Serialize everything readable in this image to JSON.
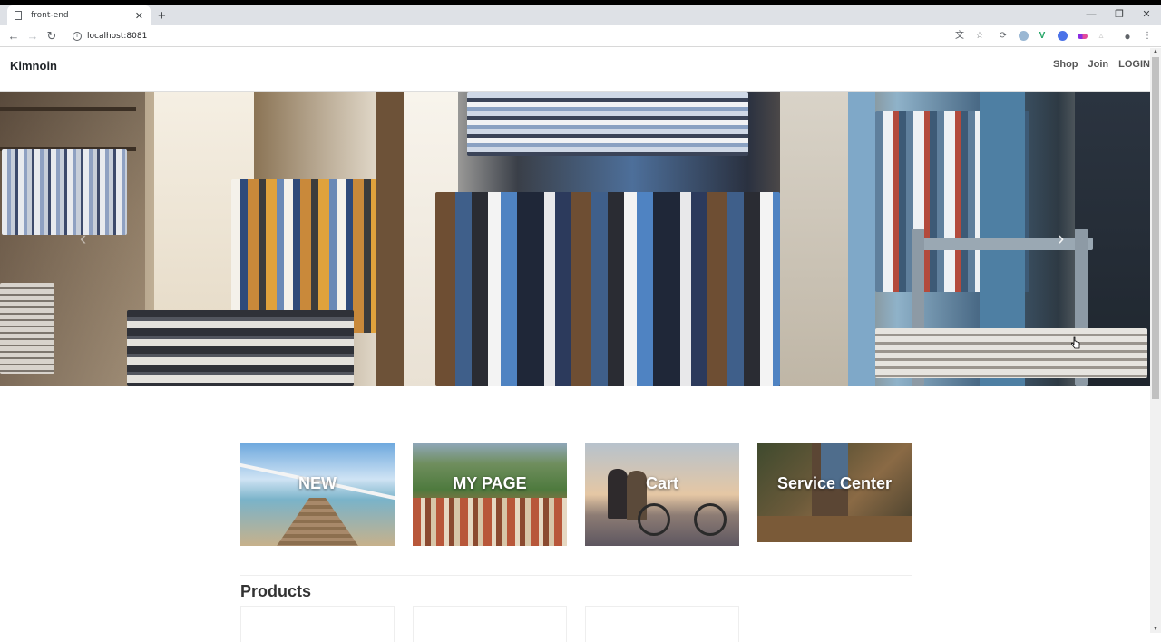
{
  "browser": {
    "tab_title": "front-end",
    "url": "localhost:8081",
    "window_controls": [
      "—",
      "❐",
      "✕"
    ],
    "new_tab_label": "+"
  },
  "navbar": {
    "brand": "Kimnoin",
    "links": [
      "Shop",
      "Join",
      "LOGIN"
    ]
  },
  "hero": {
    "prev_arrow": "‹",
    "next_arrow": "›"
  },
  "menu_cards": [
    {
      "label": "NEW",
      "icon": "pier-photo"
    },
    {
      "label": "MY PAGE",
      "icon": "city-photo"
    },
    {
      "label": "Cart",
      "icon": "bicycle-photo"
    },
    {
      "label": "Service Center",
      "icon": "forest-photo"
    }
  ],
  "products": {
    "title": "Products"
  },
  "colors": {
    "extension_green": "#1ea362",
    "extension_blue": "#4b72e8",
    "extension_purple": "#8a2be2",
    "extension_pink": "#e14b9b"
  }
}
